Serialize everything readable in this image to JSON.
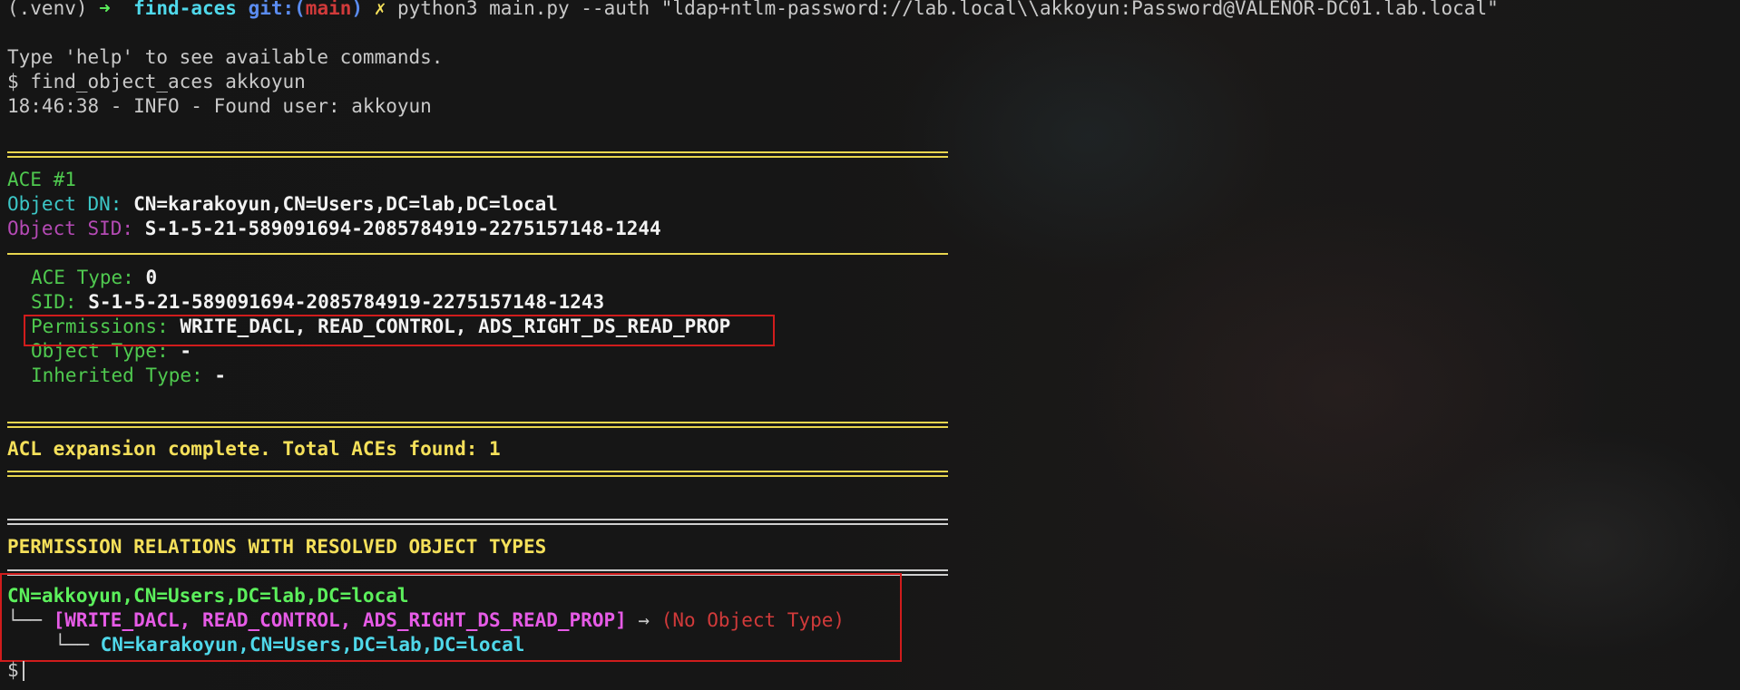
{
  "prompt": {
    "venv": "(.venv)",
    "arrow": "➜",
    "dir": "find-aces",
    "git_prefix": "git:(",
    "branch": "main",
    "git_suffix": ")",
    "dirty": "✗",
    "command": "python3 main.py --auth \"ldap+ntlm-password://lab.local\\\\akkoyun:Password@VALENOR-DC01.lab.local\""
  },
  "intro": {
    "help": "Type 'help' to see available commands.",
    "shell_prompt": "$",
    "user_command": "find_object_aces akkoyun",
    "info": "18:46:38 - INFO - Found user: akkoyun"
  },
  "ace": {
    "header": "ACE #1",
    "object_dn_label": "Object DN:",
    "object_dn": "CN=karakoyun,CN=Users,DC=lab,DC=local",
    "object_sid_label": "Object SID:",
    "object_sid": "S-1-5-21-589091694-2085784919-2275157148-1244",
    "ace_type_label": "ACE Type:",
    "ace_type": "0",
    "sid_label": "SID:",
    "sid": "S-1-5-21-589091694-2085784919-2275157148-1243",
    "permissions_label": "Permissions:",
    "permissions": "WRITE_DACL, READ_CONTROL, ADS_RIGHT_DS_READ_PROP",
    "object_type_label": "Object Type:",
    "object_type": "-",
    "inherited_type_label": "Inherited Type:",
    "inherited_type": "-"
  },
  "summary": "ACL expansion complete. Total ACEs found: 1",
  "relations": {
    "title": "PERMISSION RELATIONS WITH RESOLVED OBJECT TYPES",
    "source": "CN=akkoyun,CN=Users,DC=lab,DC=local",
    "branch1": "└──",
    "perms": "[WRITE_DACL, READ_CONTROL, ADS_RIGHT_DS_READ_PROP]",
    "arrow": "→",
    "object_type_note": "(No Object Type)",
    "branch2": "└──",
    "target": "CN=karakoyun,CN=Users,DC=lab,DC=local"
  },
  "final_prompt": "$",
  "colors": {
    "highlight_box": "#d01c1c",
    "separator_yellow": "#e8d54e",
    "separator_white": "#cfcfcf"
  }
}
